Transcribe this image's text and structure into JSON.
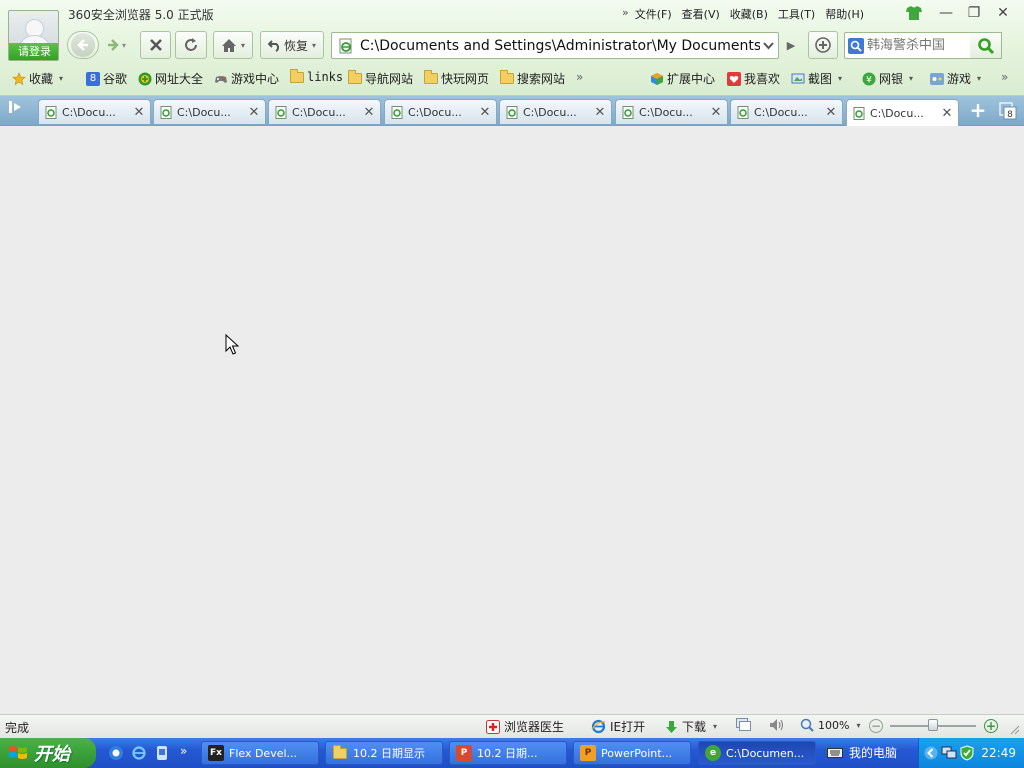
{
  "window": {
    "title": "360安全浏览器 5.0 正式版",
    "login_label": "请登录"
  },
  "menu": {
    "items": [
      "文件(F)",
      "查看(V)",
      "收藏(B)",
      "工具(T)",
      "帮助(H)"
    ],
    "overflow": "»"
  },
  "window_controls": {
    "minimize": "—",
    "restore": "❐",
    "close": "✕"
  },
  "toolbar": {
    "restore_label": "恢复",
    "address": "C:\\Documents and Settings\\Administrator\\My Documents\\Fle",
    "search_placeholder": "韩海警杀中国",
    "go_glyph": "▶"
  },
  "favorites": {
    "items": [
      {
        "label": "收藏",
        "icon": "star-icon",
        "has_caret": true
      },
      {
        "label": "谷歌",
        "icon": "google-icon"
      },
      {
        "label": "网址大全",
        "icon": "plus-circle-icon"
      },
      {
        "label": "游戏中心",
        "icon": "gamepad-icon"
      },
      {
        "label": "links",
        "icon": "folder-icon"
      },
      {
        "label": "导航网站",
        "icon": "folder-icon"
      },
      {
        "label": "快玩网页",
        "icon": "folder-icon"
      },
      {
        "label": "搜索网站",
        "icon": "folder-icon"
      }
    ],
    "overflow": "»",
    "right_items": [
      {
        "label": "扩展中心",
        "icon": "cube-icon"
      },
      {
        "label": "我喜欢",
        "icon": "heart-icon"
      },
      {
        "label": "截图",
        "icon": "screenshot-icon",
        "has_caret": true
      },
      {
        "label": "网银",
        "icon": "bank-icon",
        "has_caret": true
      },
      {
        "label": "游戏",
        "icon": "game-icon",
        "has_caret": true
      }
    ],
    "right_overflow": "»"
  },
  "tabs": [
    {
      "label": "C:\\Docu..."
    },
    {
      "label": "C:\\Docu..."
    },
    {
      "label": "C:\\Docu..."
    },
    {
      "label": "C:\\Docu..."
    },
    {
      "label": "C:\\Docu..."
    },
    {
      "label": "C:\\Docu..."
    },
    {
      "label": "C:\\Docu..."
    },
    {
      "label": "C:\\Docu...",
      "active": true
    }
  ],
  "tab_count": "8",
  "statusbar": {
    "status": "完成",
    "doctor": "浏览器医生",
    "ie_open": "IE打开",
    "download": "下载",
    "zoom": "100%",
    "zoom_level": 0.5
  },
  "taskbar": {
    "start_label": "开始",
    "tasks": [
      {
        "label": "Flex Devel...",
        "icon": "Fx"
      },
      {
        "label": "10.2 日期显示",
        "icon": "folder"
      },
      {
        "label": "10.2 日期...",
        "icon": "P"
      },
      {
        "label": "PowerPoint...",
        "icon": "P"
      },
      {
        "label": "C:\\Documen...",
        "icon": "e",
        "active": true
      }
    ],
    "my_computer": "我的电脑",
    "clock": "22:49"
  },
  "colors": {
    "header_bg": "#e4f3dc",
    "tab_strip": "#8fb6d3",
    "accent_green": "#34a024",
    "taskbar_blue": "#2458d3",
    "start_green": "#3a9d38"
  }
}
